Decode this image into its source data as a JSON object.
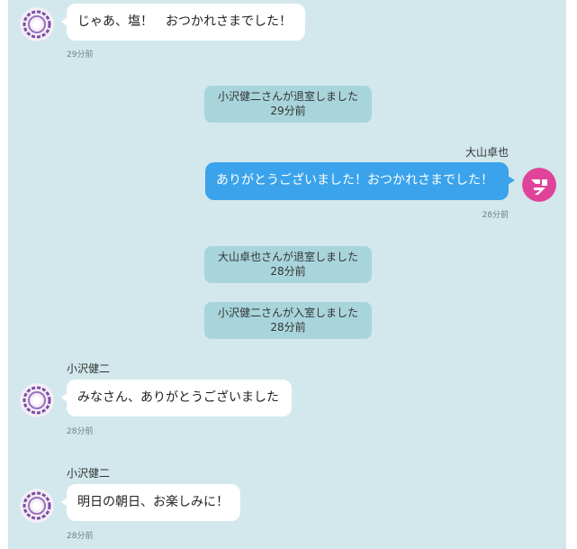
{
  "messages": [
    {
      "sender": "",
      "text": "じゃあ、塩！　おつかれさまでした！",
      "time": "29分前",
      "avatar": "ornament-avatar-icon"
    },
    {
      "sender": "大山卓也",
      "text": "ありがとうございました！おつかれさまでした！",
      "time": "28分前",
      "avatar": "pink-logo-avatar-icon"
    },
    {
      "sender": "小沢健二",
      "text": "みなさん、ありがとうございました",
      "time": "28分前",
      "avatar": "ornament-avatar-icon"
    },
    {
      "sender": "小沢健二",
      "text": "明日の朝日、お楽しみに！",
      "time": "28分前",
      "avatar": "ornament-avatar-icon"
    }
  ],
  "system_messages": [
    {
      "text": "小沢健二さんが退室しました",
      "time": "29分前"
    },
    {
      "text": "大山卓也さんが退室しました",
      "time": "28分前"
    },
    {
      "text": "小沢健二さんが入室しました",
      "time": "28分前"
    }
  ],
  "colors": {
    "background": "#d2e8ec",
    "own_bubble": "#3aa3eb",
    "other_bubble": "#ffffff",
    "system_bubble": "#a8d5db",
    "avatar_pink": "#e0449a",
    "avatar_purple": "#7b4ea0"
  }
}
